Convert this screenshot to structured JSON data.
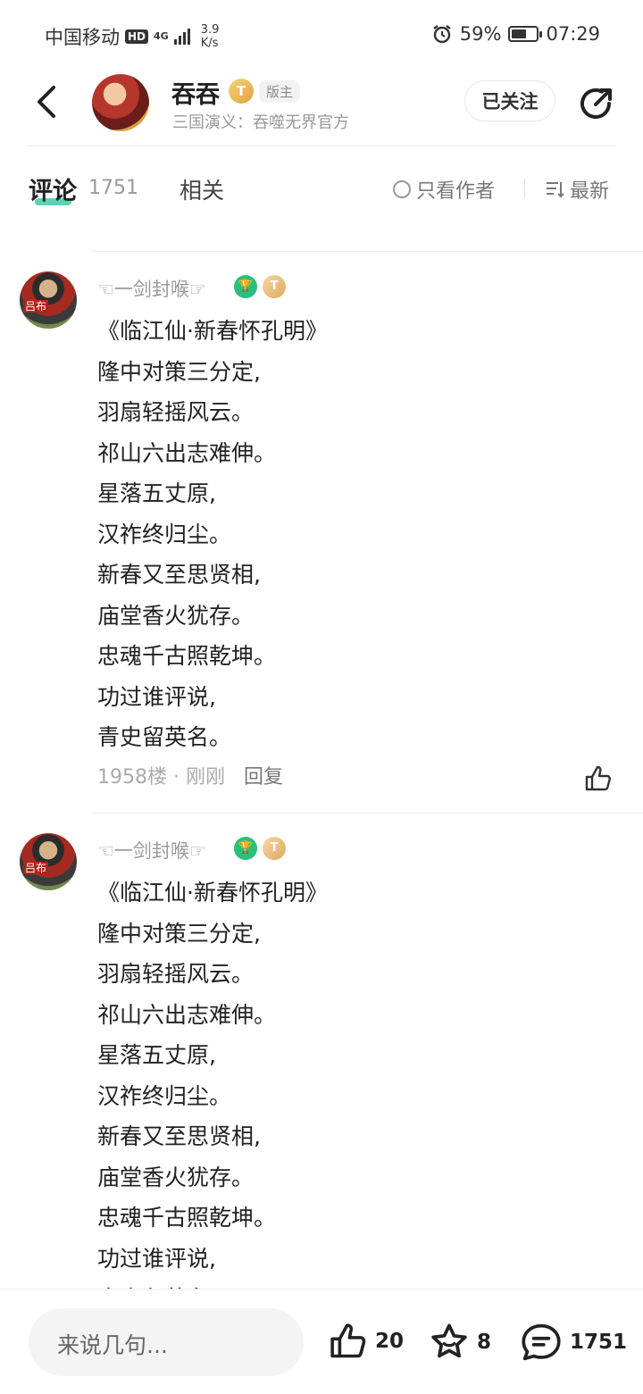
{
  "status_bar": {
    "carrier": "中国移动",
    "hd": "HD",
    "network": "4G",
    "speed_value": "3.9",
    "speed_unit": "K/s",
    "battery": "59%",
    "battery_level": 0.59,
    "time": "07:29"
  },
  "header": {
    "name": "吞吞",
    "badge_letter": "T",
    "role": "版主",
    "subtitle": "三国演义：吞噬无界官方",
    "follow_label": "已关注"
  },
  "tabs": {
    "comment_label": "评论",
    "comment_count": "1751",
    "related_label": "相关",
    "author_only_label": "只看作者",
    "sort_label": "最新"
  },
  "comments": [
    {
      "username": "☜一剑封喉☞",
      "avatar_tag": "吕布",
      "badge_letter": "T",
      "lines": [
        "《临江仙·新春怀孔明》",
        "隆中对策三分定,",
        "羽扇轻摇风云。",
        "祁山六出志难伸。",
        "星落五丈原,",
        "汉祚终归尘。",
        "新春又至思贤相,",
        "庙堂香火犹存。",
        "忠魂千古照乾坤。",
        "功过谁评说,",
        "青史留英名。"
      ],
      "floor": "1958楼",
      "time": "刚刚",
      "reply_label": "回复"
    },
    {
      "username": "☜一剑封喉☞",
      "avatar_tag": "吕布",
      "badge_letter": "T",
      "lines": [
        "《临江仙·新春怀孔明》",
        "隆中对策三分定,",
        "羽扇轻摇风云。",
        "祁山六出志难伸。",
        "星落五丈原,",
        "汉祚终归尘。",
        "新春又至思贤相,",
        "庙堂香火犹存。",
        "忠魂千古照乾坤。",
        "功过谁评说,",
        "青史留英名。"
      ]
    }
  ],
  "bottom_bar": {
    "input_placeholder": "来说几句...",
    "likes": "20",
    "stars": "8",
    "comments": "1751"
  }
}
